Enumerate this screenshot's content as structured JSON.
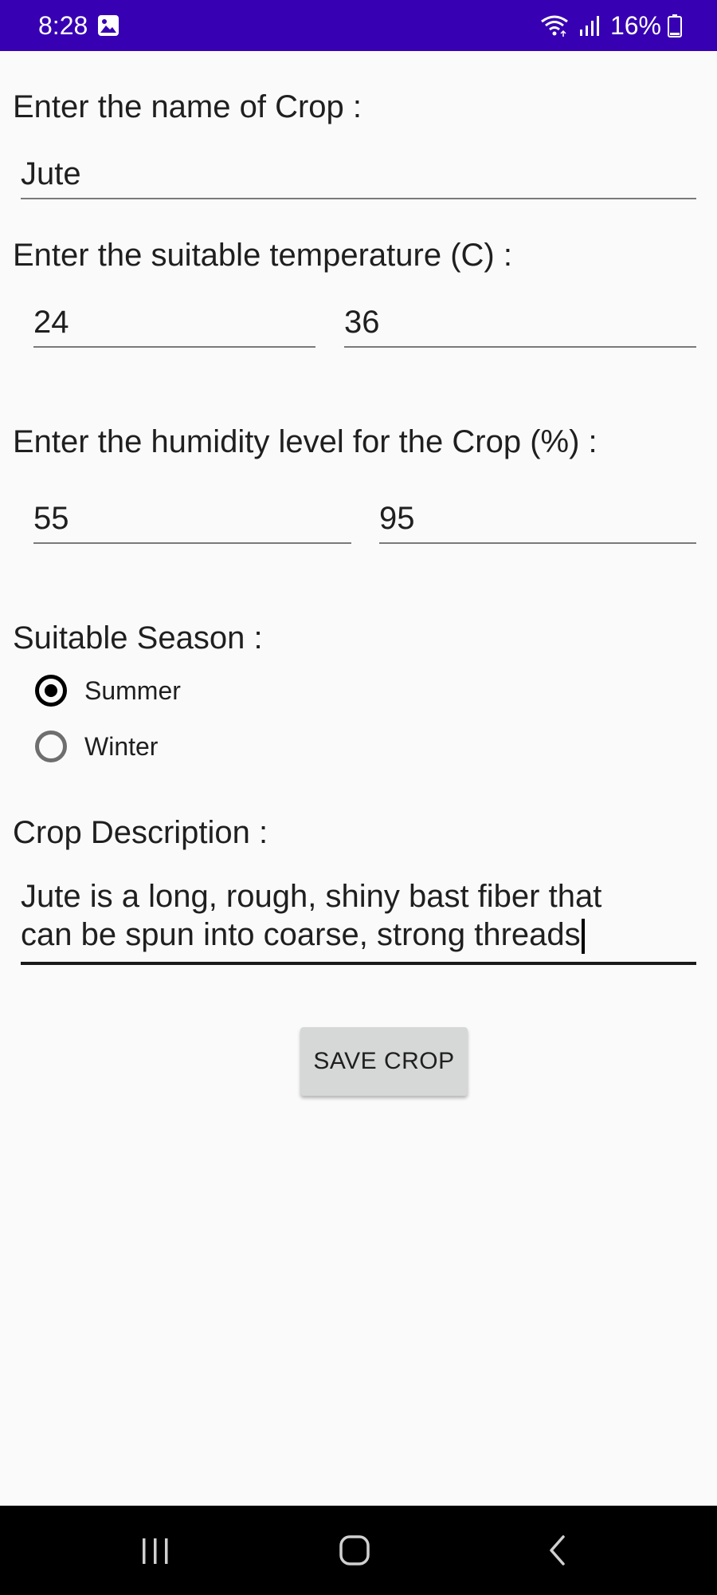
{
  "status_bar": {
    "time": "8:28",
    "battery": "16%",
    "background_color": "#3700b3",
    "icons": [
      "gallery-icon",
      "wifi-icon",
      "signal-icon",
      "battery-icon"
    ]
  },
  "form": {
    "crop_name": {
      "label": "Enter the name of Crop :",
      "value": "Jute"
    },
    "temperature": {
      "label": "Enter the suitable temperature (C) :",
      "min_value": "24",
      "max_value": "36"
    },
    "humidity": {
      "label": "Enter the humidity level for the Crop (%) :",
      "min_value": "55",
      "max_value": "95"
    },
    "season": {
      "label": "Suitable Season :",
      "options": [
        {
          "label": "Summer",
          "checked": true
        },
        {
          "label": "Winter",
          "checked": false
        }
      ]
    },
    "description": {
      "label": "Crop Description :",
      "line1": "Jute is a long, rough, shiny bast fiber that",
      "line2": "can be spun into coarse, strong threads"
    },
    "save_button_label": "SAVE CROP"
  },
  "nav_bar": {
    "icons": [
      "recent-apps-icon",
      "home-icon",
      "back-icon"
    ]
  }
}
